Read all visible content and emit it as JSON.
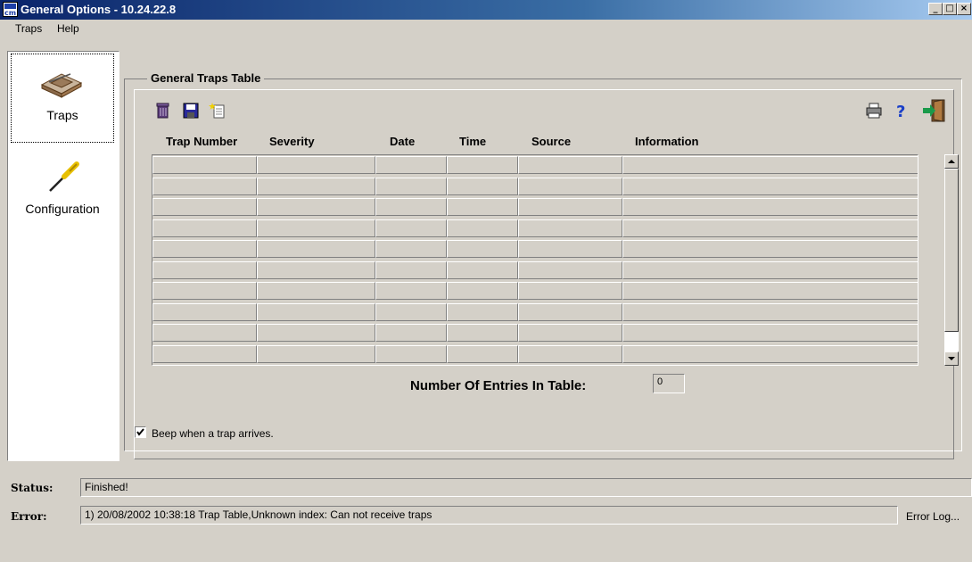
{
  "window": {
    "title": "General Options - 10.24.22.8",
    "icon": "cm-app-icon",
    "controls": [
      "minimize",
      "maximize",
      "close"
    ]
  },
  "menu": {
    "items": [
      {
        "label": "Traps"
      },
      {
        "label": "Help"
      }
    ]
  },
  "sidebar": {
    "items": [
      {
        "label": "Traps",
        "icon": "trap-icon",
        "selected": true
      },
      {
        "label": "Configuration",
        "icon": "screwdriver-icon",
        "selected": false
      }
    ]
  },
  "panel": {
    "title": "General Traps Table",
    "toolbar_left": [
      "delete-icon",
      "save-icon",
      "new-document-icon"
    ],
    "toolbar_right": [
      "print-icon",
      "help-icon",
      "exit-icon"
    ]
  },
  "table": {
    "columns": [
      "Trap Number",
      "Severity",
      "Date",
      "Time",
      "Source",
      "Information"
    ],
    "rows": []
  },
  "entries": {
    "label": "Number Of Entries In Table:",
    "value": "0"
  },
  "beep": {
    "label": "Beep when a trap arrives.",
    "checked": true
  },
  "status": {
    "label": "Status:",
    "value": "Finished!"
  },
  "error": {
    "label": "Error:",
    "value": "1) 20/08/2002 10:38:18 Trap Table,Unknown index: Can not receive traps",
    "log_label": "Error Log..."
  }
}
